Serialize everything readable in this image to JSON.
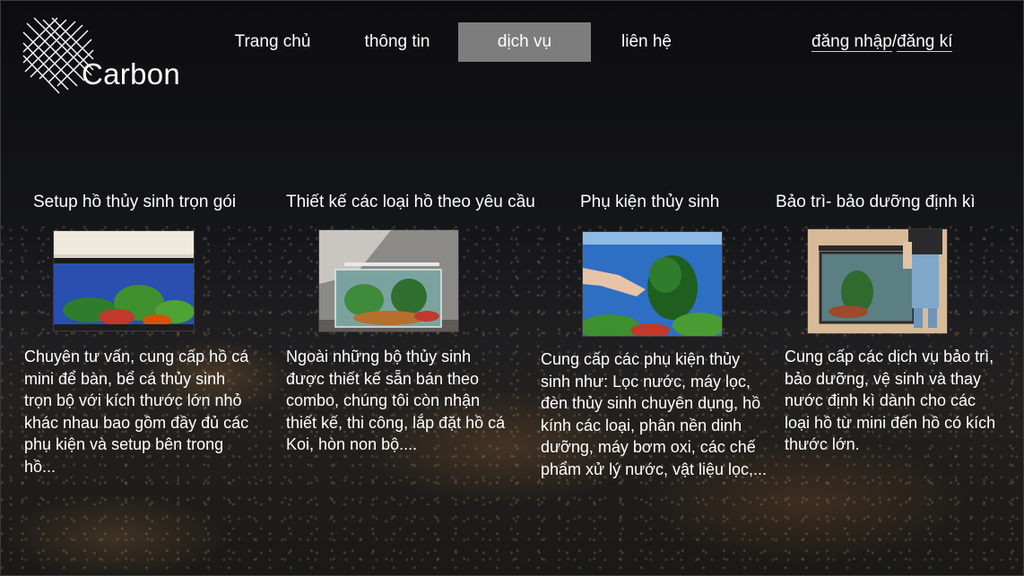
{
  "brand": {
    "name": "Carbon"
  },
  "nav": {
    "items": [
      {
        "label": "Trang chủ"
      },
      {
        "label": "thông tin"
      },
      {
        "label": "dịch vụ"
      },
      {
        "label": "liên hệ"
      }
    ],
    "active_index": 2,
    "login_label": "đăng nhập",
    "separator": "/",
    "register_label": "đăng kí"
  },
  "services": [
    {
      "title": "Setup hồ thủy sinh trọn gói",
      "image": "aquarium-full-setup-photo",
      "description": "Chuyên tư vấn, cung cấp hồ cá mini để bàn, bể cá thủy sinh trọn bộ với kích thước lớn nhỏ khác nhau bao gồm đầy đủ các phụ kiện và setup bên trong hồ..."
    },
    {
      "title": "Thiết kế các loại hồ theo yêu cầu",
      "image": "custom-aquarium-photo",
      "description": "Ngoài những bộ thủy sinh được thiết kế sẵn bán theo combo, chúng tôi còn nhận thiết kế, thi công, lắp đặt hồ cá Koi, hòn non bộ...."
    },
    {
      "title": "Phụ kiện thủy sinh",
      "image": "aquatic-plant-accessory-photo",
      "description": "Cung cấp các phụ kiện thủy sinh như: Lọc nước, máy lọc, đèn thủy sinh chuyên dụng, hồ kính các loại, phân nền dinh dưỡng, máy bơm oxi, các chế phẩm xử lý nước, vật liệu lọc,..."
    },
    {
      "title": "Bảo trì- bảo dưỡng định kì",
      "image": "aquarium-maintenance-photo",
      "description": "Cung cấp các dịch vụ bảo trì, bảo dưỡng, vệ sinh và thay nước định kì dành cho các loại hồ từ mini đến hồ có kích thước lớn."
    }
  ],
  "colors": {
    "background": "#141518",
    "active_nav": "#7d7d7d",
    "text": "#ffffff"
  }
}
